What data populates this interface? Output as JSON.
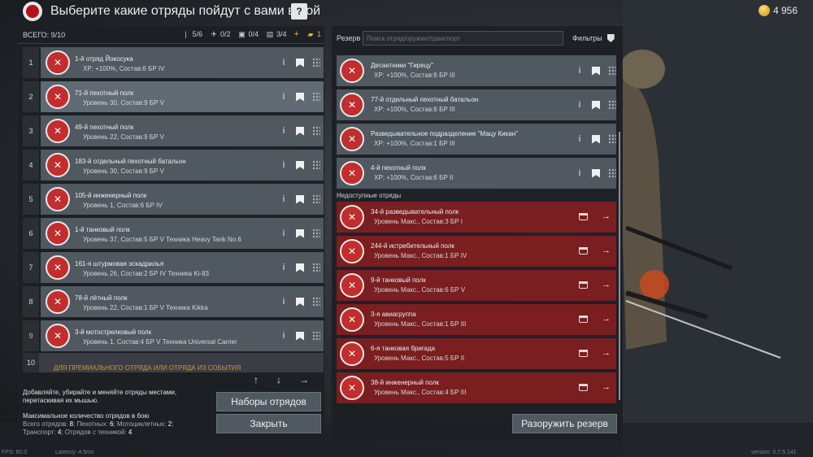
{
  "header": {
    "title": "Выберите какие отряды пойдут с вами в бой",
    "help": "?",
    "gold": "4 956"
  },
  "left": {
    "total": "ВСЕГО: 9/10",
    "stats": [
      {
        "icon": "rifle-icon",
        "value": "5/6"
      },
      {
        "icon": "plane-icon",
        "value": "0/2"
      },
      {
        "icon": "vehicle-icon",
        "value": "0/4"
      },
      {
        "icon": "tank-icon",
        "value": "3/4"
      },
      {
        "icon": "plus-icon",
        "value": "+"
      },
      {
        "icon": "car-icon",
        "value": "1"
      }
    ],
    "rows": [
      {
        "num": "1",
        "name": "1-й отряд Йокосука",
        "sub": "XP: +100%, Состав:6  БР IV"
      },
      {
        "num": "2",
        "name": "71-й пехотный полк",
        "sub": "Уровень 30, Состав:9  БР V"
      },
      {
        "num": "3",
        "name": "49-й пехотный полк",
        "sub": "Уровень 22, Состав:9  БР V"
      },
      {
        "num": "4",
        "name": "183-й отдельный пехотный батальон",
        "sub": "Уровень 30, Состав:9  БР V"
      },
      {
        "num": "5",
        "name": "105-й инженерный полк",
        "sub": "Уровень 1, Состав:6  БР IV"
      },
      {
        "num": "6",
        "name": "1-й танковый полк",
        "sub": "Уровень 37, Состав:5  БР V  Техника Heavy Tank No.6"
      },
      {
        "num": "7",
        "name": "161-я штурмовая эскадрилья",
        "sub": "Уровень 26, Состав:2  БР IV  Техника Ki-83"
      },
      {
        "num": "8",
        "name": "78-й лётный полк",
        "sub": "Уровень 22, Состав:1  БР V  Техника Kikka"
      },
      {
        "num": "9",
        "name": "3-й мотострелковый полк",
        "sub": "Уровень 1, Состав:4  БР V  Техника Universal Carrier"
      }
    ],
    "row10": {
      "num": "10",
      "text": "ДЛЯ ПРЕМИАЛЬНОГО ОТРЯДА ИЛИ ОТРЯДА ИЗ СОБЫТИЯ"
    },
    "info": {
      "line1": "Добавляйте, убирайте и меняйте отряды местами, перетаскивая их мышью.",
      "max": "Максимальное количество отрядов в бою",
      "l1": "Всего отрядов: ",
      "v1": "8",
      "l2": "; Пехотных: ",
      "v2": "6",
      "l3": "; Мотоциклетных: ",
      "v3": "2",
      "l4": ";",
      "l5": "Транспорт: ",
      "v5": "4",
      "l6": "; Отрядов с техникой: ",
      "v6": "4"
    },
    "btn_presets": "Наборы отрядов",
    "btn_close": "Закрыть"
  },
  "right": {
    "reserve": "Резерв",
    "search_placeholder": "Поиск отряд/оружие/транспорт",
    "filters": "Фильтры",
    "rows": [
      {
        "name": "Десантники \"Гирецу\"",
        "sub": "XP: +100%, Состав:6  БР III"
      },
      {
        "name": "77-й отдельный пехотный батальон",
        "sub": "XP: +100%, Состав:6  БР III"
      },
      {
        "name": "Разведывательное подразделение \"Мацу Кикан\"",
        "sub": "XP: +100%, Состав:1  БР III"
      },
      {
        "name": "4-й пехотный полк",
        "sub": "XP: +100%, Состав:6  БР II"
      }
    ],
    "unavailable": "Недоступные отряды",
    "locked": [
      {
        "name": "34-й разведывательный полк",
        "sub": "Уровень Макс., Состав:3  БР I"
      },
      {
        "name": "244-й истребительный полк",
        "sub": "Уровень Макс., Состав:1  БР IV"
      },
      {
        "name": "9-й танковый полк",
        "sub": "Уровень Макс., Состав:6  БР V"
      },
      {
        "name": "3-я авиагруппа",
        "sub": "Уровень Макс., Состав:1  БР III"
      },
      {
        "name": "6-я танковая бригада",
        "sub": "Уровень Макс., Состав:5  БР II"
      },
      {
        "name": "38-й инженерный полк",
        "sub": "Уровень Макс., Состав:4  БР III"
      }
    ],
    "btn_disarm": "Разоружить резерв"
  },
  "footer": {
    "fps": "FPS: 60.0",
    "latency": "Latency: 4.5ms",
    "version": "version: 0.7.5.141"
  },
  "colors": {
    "accent": "#e3b23c",
    "locked": "#7a1e20",
    "emblem": "#c22d2d"
  }
}
